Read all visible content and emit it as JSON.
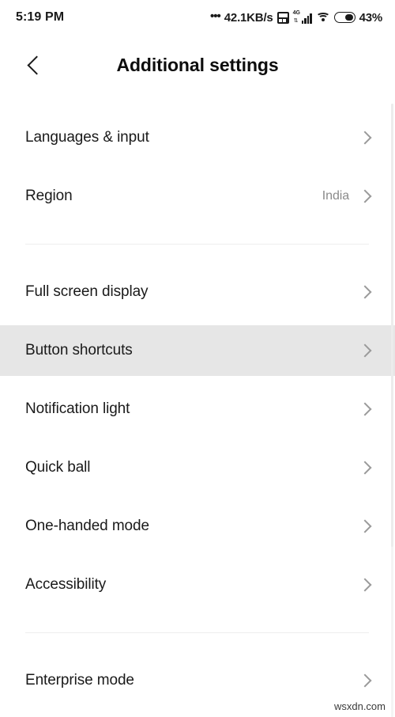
{
  "status_bar": {
    "time": "5:19 PM",
    "dots": "•••",
    "network_speed": "42.1KB/s",
    "sim_icon": "sim-card-icon",
    "network_type": "4G",
    "signal_icon": "cellular-signal-icon",
    "wifi_icon": "wifi-icon",
    "battery_icon": "battery-icon",
    "battery_percent": "43%"
  },
  "app_bar": {
    "back_icon": "back-chevron-icon",
    "title": "Additional settings"
  },
  "list": {
    "group_1": [
      {
        "label": "Languages & input",
        "value": "",
        "chevron": "chevron-right-icon",
        "highlighted": false
      },
      {
        "label": "Region",
        "value": "India",
        "chevron": "chevron-right-icon",
        "highlighted": false
      }
    ],
    "group_2": [
      {
        "label": "Full screen display",
        "value": "",
        "chevron": "chevron-right-icon",
        "highlighted": false
      },
      {
        "label": "Button shortcuts",
        "value": "",
        "chevron": "chevron-right-icon",
        "highlighted": true
      },
      {
        "label": "Notification light",
        "value": "",
        "chevron": "chevron-right-icon",
        "highlighted": false
      },
      {
        "label": "Quick ball",
        "value": "",
        "chevron": "chevron-right-icon",
        "highlighted": false
      },
      {
        "label": "One-handed mode",
        "value": "",
        "chevron": "chevron-right-icon",
        "highlighted": false
      },
      {
        "label": "Accessibility",
        "value": "",
        "chevron": "chevron-right-icon",
        "highlighted": false
      }
    ],
    "group_3": [
      {
        "label": "Enterprise mode",
        "value": "",
        "chevron": "chevron-right-icon",
        "highlighted": false
      }
    ]
  },
  "scrollbar": {
    "name": "vertical-scrollbar"
  },
  "watermark": {
    "text": "wsxdn.com"
  },
  "colors": {
    "background": "#ffffff",
    "text_primary": "#1a1a1a",
    "text_secondary": "#8a8a8a",
    "highlight_row": "#e6e6e6",
    "divider": "#eeeeee",
    "chevron": "#9a9a9a"
  }
}
